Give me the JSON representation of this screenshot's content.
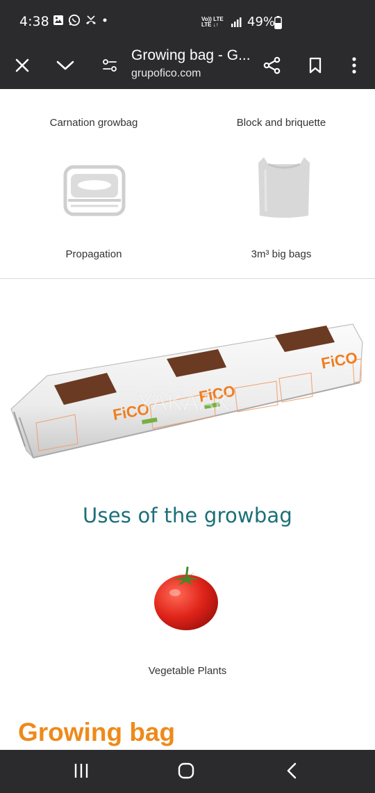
{
  "status_bar": {
    "time": "4:38",
    "network_label_top": "Vo)) LTE",
    "network_label_bottom": "LTE ↓↑",
    "battery": "49%",
    "icons": [
      "gallery-icon",
      "whatsapp-icon",
      "missed-call-icon",
      "dot-icon",
      "signal-icon",
      "battery-icon"
    ]
  },
  "toolbar": {
    "title": "Growing bag - G...",
    "url": "grupofico.com",
    "icons": [
      "close-icon",
      "chevron-down-icon",
      "page-settings-icon",
      "share-icon",
      "bookmark-icon",
      "more-icon"
    ]
  },
  "products": {
    "carnation": "Carnation growbag",
    "block": "Block and briquette",
    "propagation": "Propagation",
    "big_bags": "3m³ big bags"
  },
  "growbag_image": {
    "brand": "FiCO",
    "watermark": "YAKAAK"
  },
  "uses": {
    "title": "Uses of the growbag",
    "vegetable_label": "Vegetable Plants"
  },
  "section_heading": "Growing bag",
  "colors": {
    "chrome": "#2b2b2d",
    "teal_heading": "#1b6f78",
    "orange_heading": "#ee8a1a"
  },
  "nav_bar": {
    "icons": [
      "recents-icon",
      "home-icon",
      "back-icon"
    ]
  }
}
